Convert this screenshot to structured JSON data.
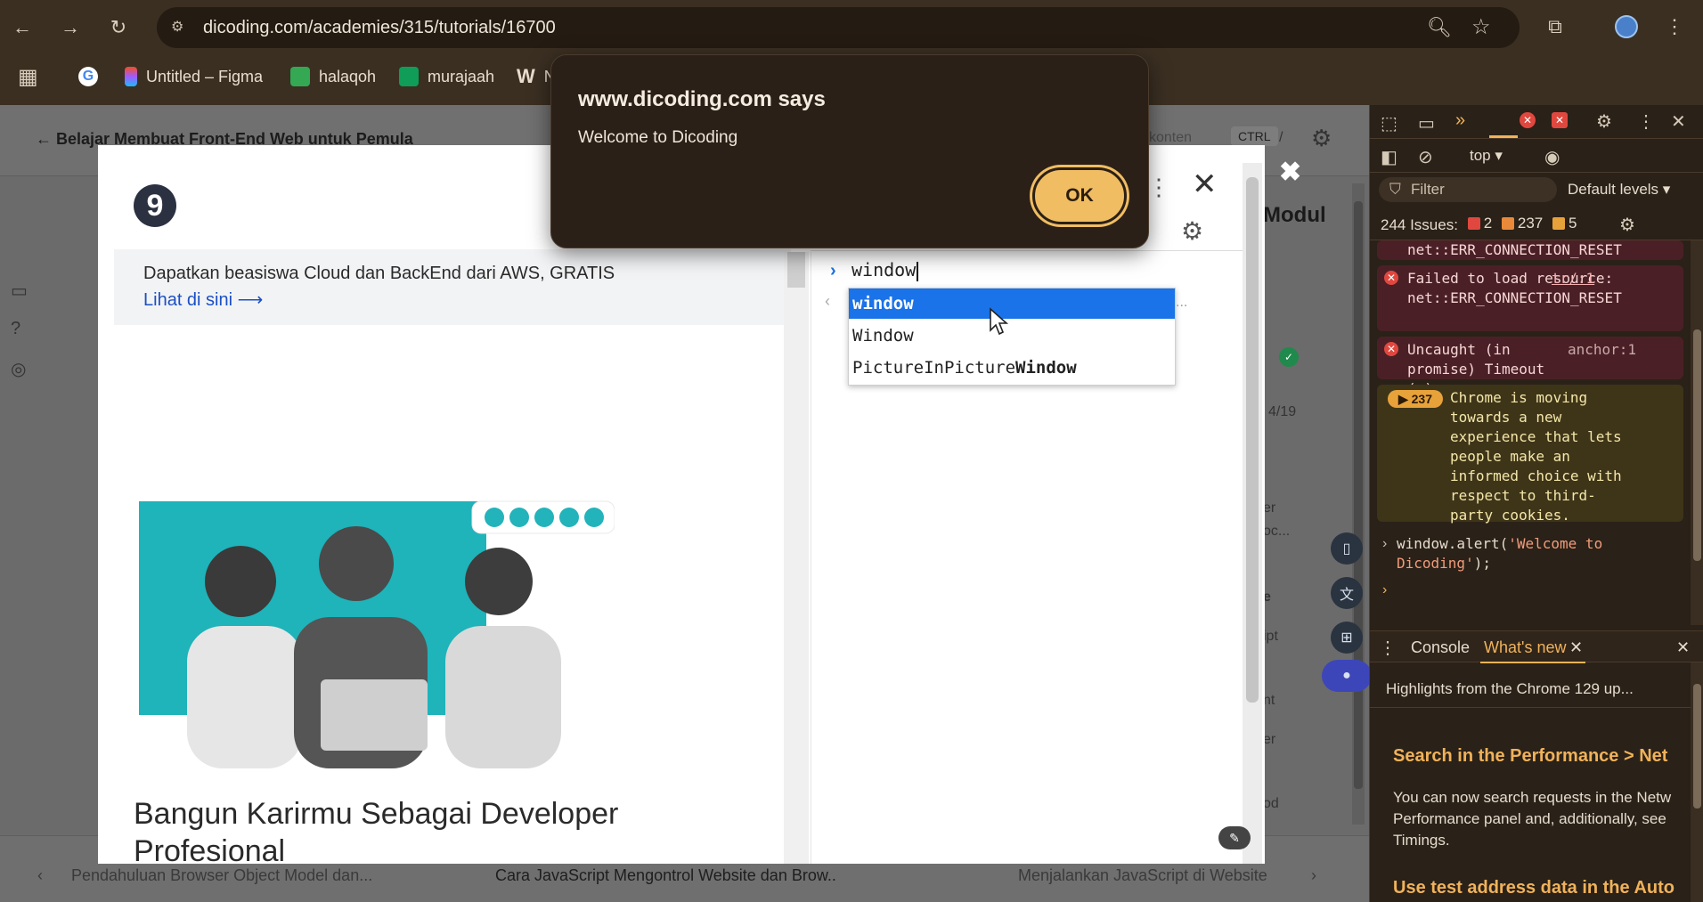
{
  "browser": {
    "url": "dicoding.com/academies/315/tutorials/16700",
    "bookmarks": [
      {
        "label": "",
        "icon": "google-icon"
      },
      {
        "label": "Untitled – Figma",
        "icon": "figma-icon"
      },
      {
        "label": "halaqoh",
        "icon": "meet-icon"
      },
      {
        "label": "murajaah",
        "icon": "sheets-icon"
      },
      {
        "label": "N",
        "icon": "w-icon"
      }
    ]
  },
  "page": {
    "back_label": "Belajar Membuat Front-End Web untuk Pemula",
    "search_hint": "konten",
    "shortcut_key": "CTRL",
    "shortcut_sep": "/",
    "modul_label": "Modul",
    "page_snippet": "4/19",
    "right_snippets": [
      "er",
      "oc...",
      "e",
      "ipt",
      "nt",
      "er",
      "od"
    ],
    "prev_lesson": "Pendahuluan Browser Object Model dan...",
    "current_lesson": "Cara JavaScript Mengontrol Website dan Brow..",
    "next_lesson": "Menjalankan JavaScript di Website"
  },
  "modal": {
    "logo_text": "9",
    "promo_text": "Dapatkan beasiswa Cloud dan BackEnd dari AWS, GRATIS",
    "promo_link": "Lihat di sini ⟶",
    "headline": "Bangun Karirmu Sebagai Developer Profesional",
    "console_input": "window",
    "autocomplete": [
      {
        "prefix": "window",
        "suffix": "",
        "selected": true
      },
      {
        "prefix": "Window",
        "suffix": "",
        "selected": false
      },
      {
        "prefix": "PictureInPicture",
        "suffix": "Window",
        "selected": false
      }
    ]
  },
  "alert": {
    "title": "www.dicoding.com says",
    "message": "Welcome to Dicoding",
    "ok_label": "OK"
  },
  "devtools": {
    "context": "top ▾",
    "filter_placeholder": "Filter",
    "levels": "Default levels ▾",
    "issues_label": "244 Issues:",
    "issues_errors": "2",
    "issues_warnings": "237",
    "issues_info": "5",
    "log_top_fragment": "net::ERR_CONNECTION_RESET",
    "log_failed": "Failed to load resource: net::ERR_CONNECTION_RESET",
    "log_failed_src": "tr/:1",
    "log_uncaught": "Uncaught (in promise) Timeout (o)",
    "log_uncaught_src": "anchor:1",
    "log_warn_count": "▶ 237",
    "log_warn_text": "Chrome is moving towards a new experience that lets people make an informed choice with respect to third-party cookies.",
    "cmd_prefix": "window.alert(",
    "cmd_string": "'Welcome to Dicoding'",
    "cmd_suffix": ");",
    "drawer_tab_console": "Console",
    "drawer_tab_whatsnew": "What's new",
    "whatsnew_intro": "Highlights from the Chrome 129 up...",
    "whatsnew_h1": "Search in the Performance > Net",
    "whatsnew_p1": "You can now search requests in the Netw Performance panel and, additionally, see Timings.",
    "whatsnew_h2": "Use test address data in the Auto"
  },
  "colors": {
    "alert_ok": "#f0bd63",
    "autocomplete_selected": "#1a73e8",
    "devtools_accent": "#f0b25a"
  }
}
